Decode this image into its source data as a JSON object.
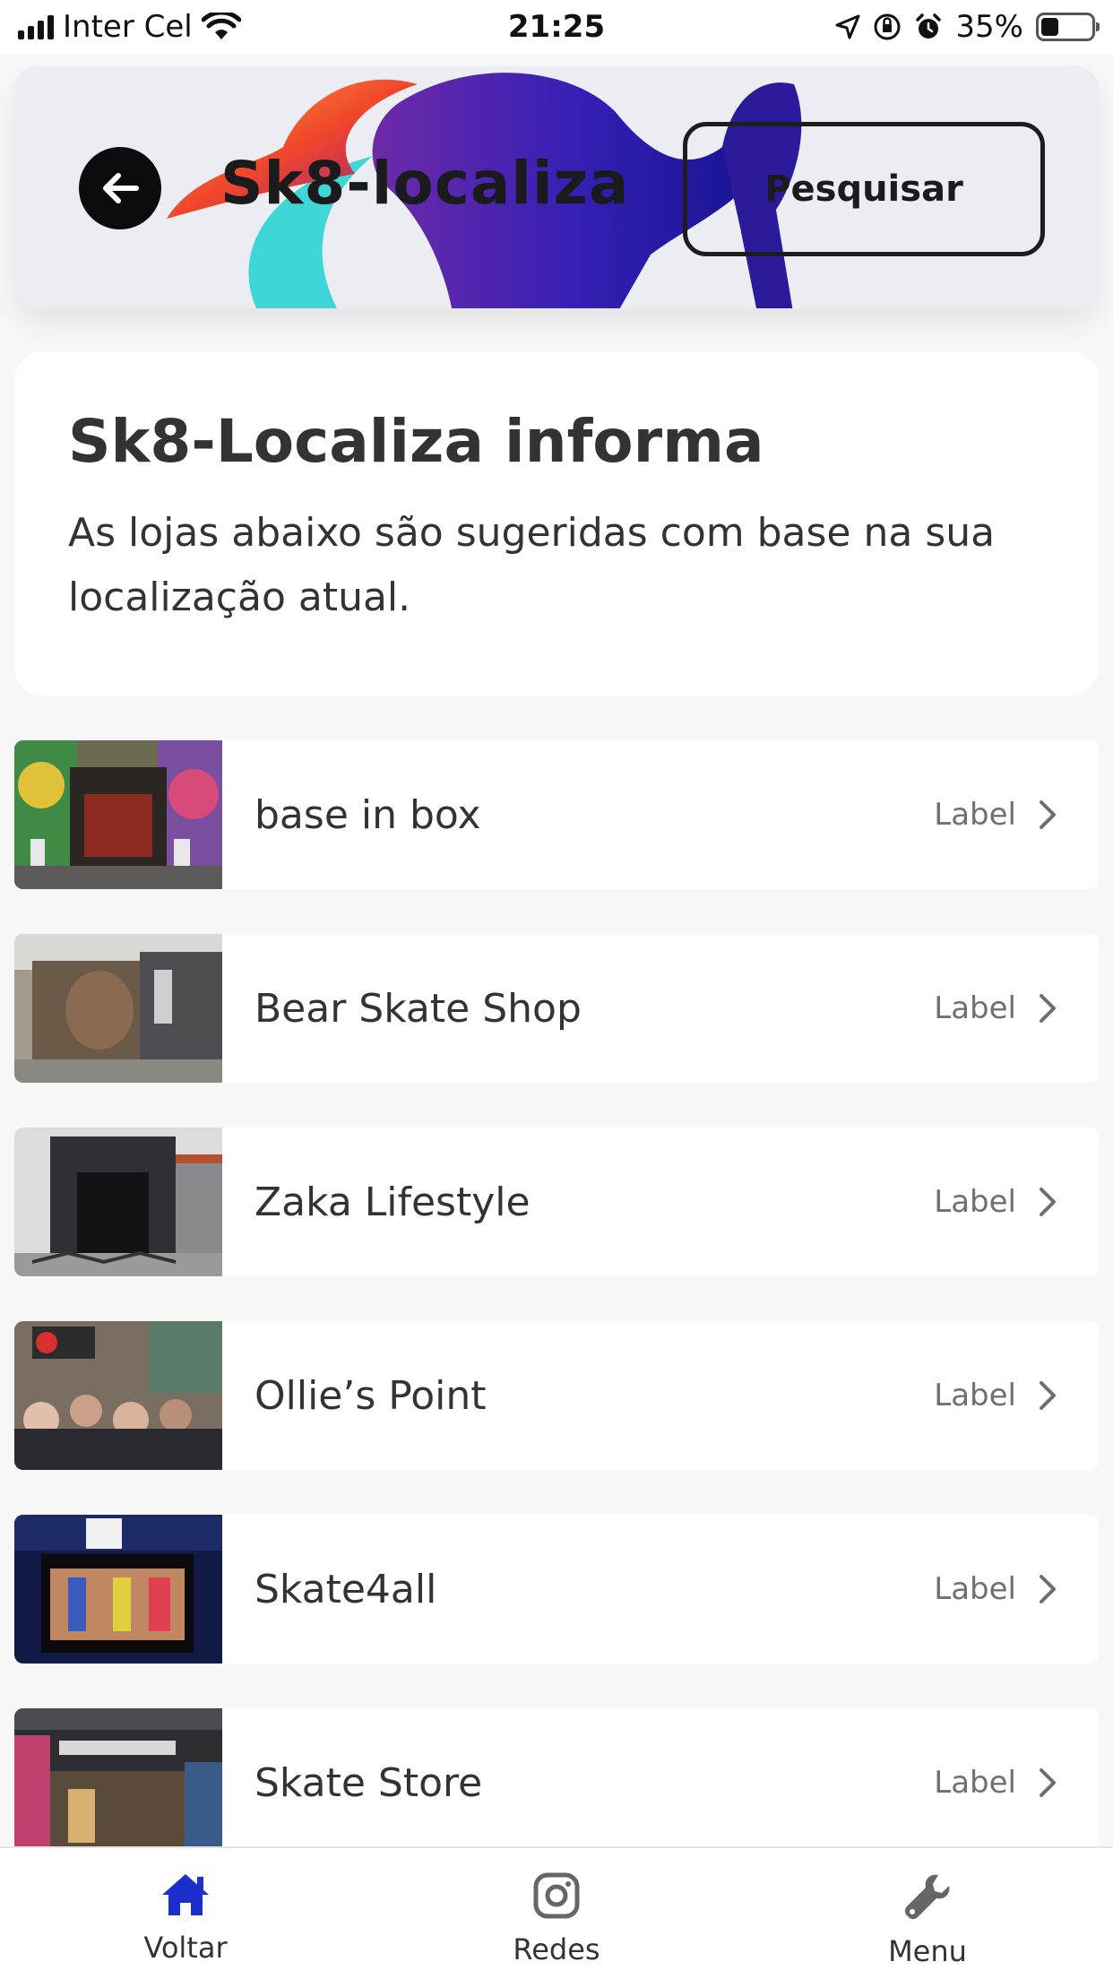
{
  "status_bar": {
    "carrier": "Inter Cel",
    "time": "21:25",
    "battery": "35%",
    "battery_level": 0.35
  },
  "header": {
    "title": "Sk8-localiza",
    "search_label": "Pesquisar",
    "back_icon": "arrow-left-icon"
  },
  "info": {
    "title": "Sk8-Localiza informa",
    "text": "As lojas abaixo são sugeridas com base na sua localização atual."
  },
  "stores": [
    {
      "name": "base in box",
      "label": "Label"
    },
    {
      "name": "Bear Skate Shop",
      "label": "Label"
    },
    {
      "name": "Zaka Lifestyle",
      "label": "Label"
    },
    {
      "name": "Ollie’s Point",
      "label": "Label"
    },
    {
      "name": "Skate4all",
      "label": "Label"
    },
    {
      "name": "Skate Store",
      "label": "Label"
    }
  ],
  "tabs": [
    {
      "label": "Voltar",
      "icon": "home-icon",
      "color": "#1b2fcf"
    },
    {
      "label": "Redes",
      "icon": "instagram-icon",
      "color": "#666666"
    },
    {
      "label": "Menu",
      "icon": "wrench-icon",
      "color": "#666666"
    }
  ]
}
